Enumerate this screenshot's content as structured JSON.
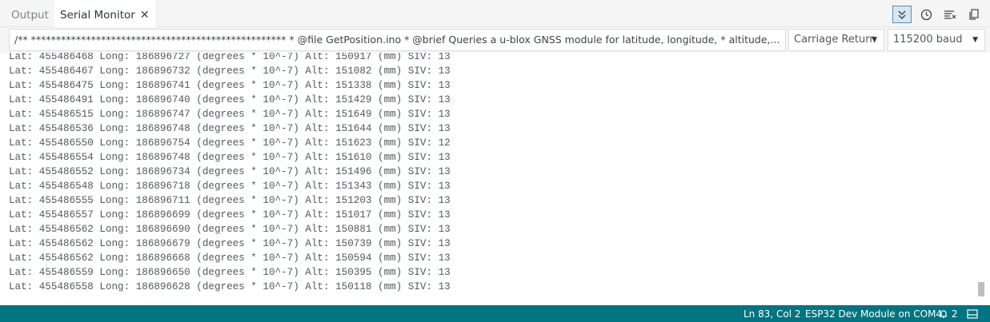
{
  "tabs": {
    "output_label": "Output",
    "serial_label": "Serial Monitor",
    "close_glyph": "✕"
  },
  "toolbar": {
    "icons": [
      "autoscroll-icon",
      "timestamp-icon",
      "clear-output-icon",
      "copy-output-icon"
    ]
  },
  "input": {
    "value": "/**  *************************************************** * @file       GetPosition.ino  * @brief      Queries a u-blox GNSS module for latitude, longitude,  *           altitude,..."
  },
  "line_ending": {
    "selected": "Carriage Return"
  },
  "baud": {
    "selected": "115200 baud"
  },
  "output": {
    "lines": [
      "Lat: 455486468 Long: 186896727 (degrees * 10^-7) Alt: 150917 (mm) SIV: 13",
      "Lat: 455486467 Long: 186896732 (degrees * 10^-7) Alt: 151082 (mm) SIV: 13",
      "Lat: 455486475 Long: 186896741 (degrees * 10^-7) Alt: 151338 (mm) SIV: 13",
      "Lat: 455486491 Long: 186896740 (degrees * 10^-7) Alt: 151429 (mm) SIV: 13",
      "Lat: 455486515 Long: 186896747 (degrees * 10^-7) Alt: 151649 (mm) SIV: 13",
      "Lat: 455486536 Long: 186896748 (degrees * 10^-7) Alt: 151644 (mm) SIV: 13",
      "Lat: 455486550 Long: 186896754 (degrees * 10^-7) Alt: 151623 (mm) SIV: 12",
      "Lat: 455486554 Long: 186896748 (degrees * 10^-7) Alt: 151610 (mm) SIV: 13",
      "Lat: 455486552 Long: 186896734 (degrees * 10^-7) Alt: 151496 (mm) SIV: 13",
      "Lat: 455486548 Long: 186896718 (degrees * 10^-7) Alt: 151343 (mm) SIV: 13",
      "Lat: 455486555 Long: 186896711 (degrees * 10^-7) Alt: 151203 (mm) SIV: 13",
      "Lat: 455486557 Long: 186896699 (degrees * 10^-7) Alt: 151017 (mm) SIV: 13",
      "Lat: 455486562 Long: 186896690 (degrees * 10^-7) Alt: 150881 (mm) SIV: 13",
      "Lat: 455486562 Long: 186896679 (degrees * 10^-7) Alt: 150739 (mm) SIV: 13",
      "Lat: 455486562 Long: 186896668 (degrees * 10^-7) Alt: 150594 (mm) SIV: 13",
      "Lat: 455486559 Long: 186896650 (degrees * 10^-7) Alt: 150395 (mm) SIV: 13",
      "Lat: 455486558 Long: 186896628 (degrees * 10^-7) Alt: 150118 (mm) SIV: 13"
    ]
  },
  "status": {
    "position": "Ln 83, Col 2",
    "board": "ESP32 Dev Module on COM4",
    "notifications": "2"
  },
  "colors": {
    "statusbar": "#007480",
    "active_toggle": "#d7e6f2"
  }
}
